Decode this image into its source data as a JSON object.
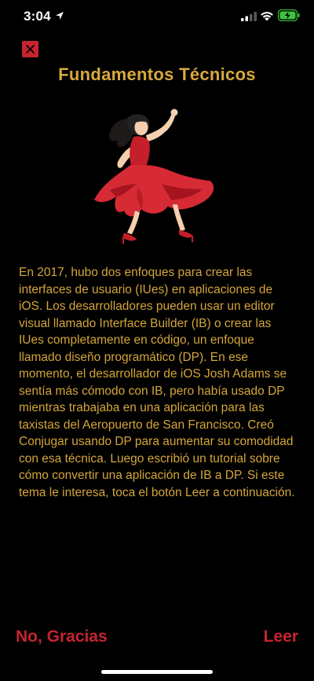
{
  "status_bar": {
    "time": "3:04",
    "icons": [
      "location-arrow-icon",
      "signal-icon",
      "wifi-icon",
      "battery-charging-icon"
    ]
  },
  "header": {
    "close_icon": "close-icon",
    "title": "Fundamentos Técnicos"
  },
  "illustration": {
    "icon": "dancer-emoji"
  },
  "body": {
    "text": "En 2017, hubo dos enfoques para crear las interfaces de usuario (IUes) en aplicaciones de iOS. Los desarrolladores pueden usar un editor visual llamado Interface Builder (IB) o crear las IUes completamente en código, un enfoque llamado diseño programático (DP). En ese momento, el desarrollador de iOS Josh Adams se sentía más cómodo con IB, pero había usado DP mientras trabajaba en una aplicación para las taxistas del Aeropuerto de San Francisco. Creó Conjugar usando DP para aumentar su comodidad con esa técnica. Luego escribió un tutorial sobre cómo convertir una aplicación de IB a DP. Si este tema le interesa, toca el botón Leer a continuación."
  },
  "footer": {
    "no_label": "No, Gracias",
    "read_label": "Leer"
  },
  "colors": {
    "background": "#000000",
    "title": "#d9a93c",
    "body_text": "#d4a53a",
    "accent_red": "#c52430"
  }
}
